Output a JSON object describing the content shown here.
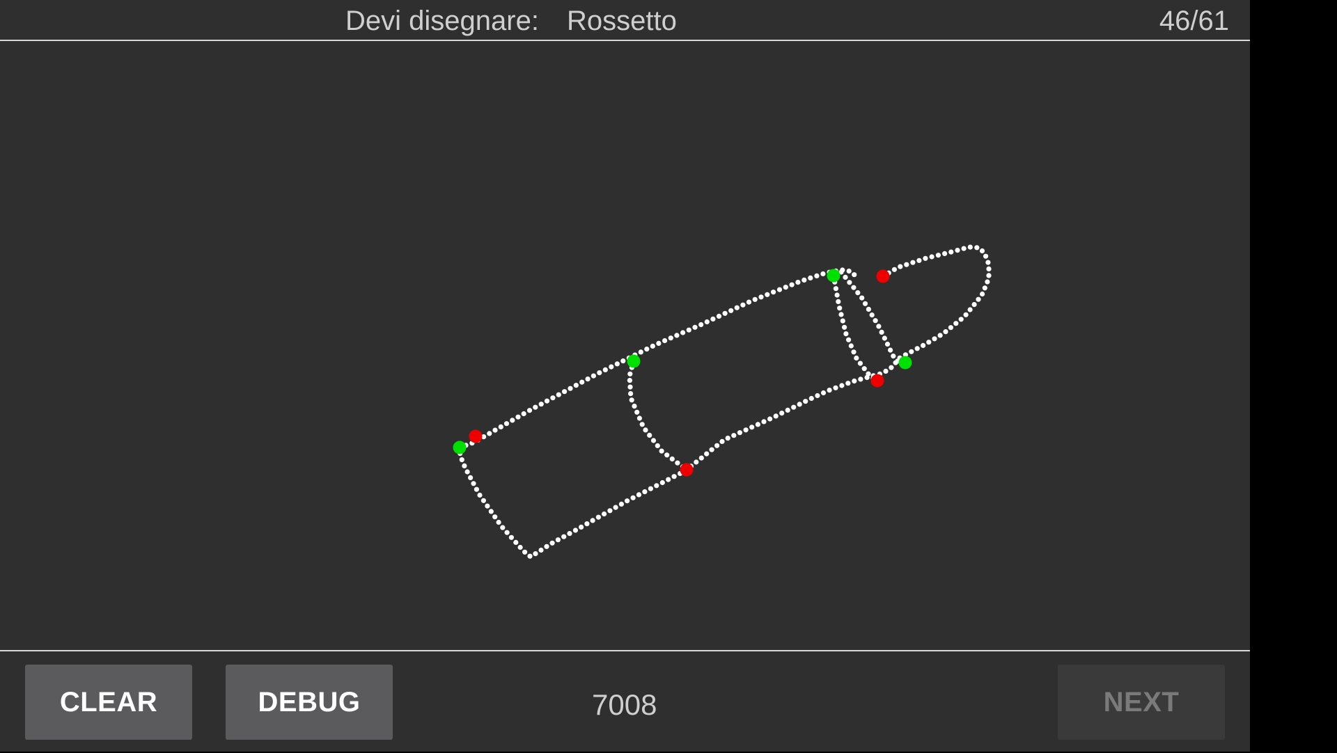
{
  "header": {
    "prompt_label": "Devi disegnare:",
    "prompt_word": "Rossetto",
    "progress": "46/61"
  },
  "drawing": {
    "subject": "lipstick-outline",
    "stroke_color": "#ffffff",
    "start_marker_color": "#00e000",
    "end_marker_color": "#ee0000",
    "stroke_count": 5
  },
  "footer": {
    "clear_label": "CLEAR",
    "debug_label": "DEBUG",
    "score": "7008",
    "next_label": "NEXT",
    "next_enabled": false
  },
  "colors": {
    "background": "#2f2f2f",
    "divider": "#d9d9d9",
    "button": "#5b5b5d",
    "button_disabled": "#3a3a3a"
  }
}
